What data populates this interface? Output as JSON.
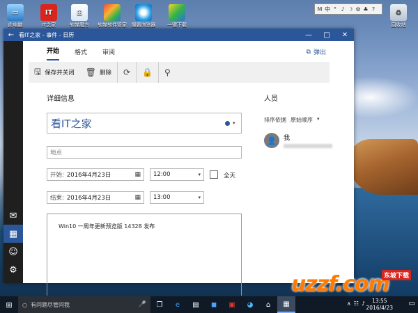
{
  "desktop": {
    "icons": [
      {
        "label": "此电脑",
        "icon": "computer-icon"
      },
      {
        "label": "IT之家",
        "icon": "it-home-icon",
        "glyph": "IT"
      },
      {
        "label": "软媒魔方",
        "icon": "cube-icon"
      },
      {
        "label": "软媒软件管家",
        "icon": "software-manager-icon"
      },
      {
        "label": "搜霸浏览器",
        "icon": "browser-icon"
      },
      {
        "label": "一键下载",
        "icon": "download-icon"
      },
      {
        "label": "回收站",
        "icon": "recycle-bin-icon"
      }
    ],
    "tray_widget": [
      "M",
      "中",
      "°",
      "♪",
      "☽",
      "⚙",
      "♣",
      "?"
    ]
  },
  "window": {
    "title": "看IT之家 - 事件 - 日历",
    "buttons": {
      "minimize": "—",
      "maximize": "□",
      "close": "✕"
    },
    "tabs": [
      {
        "label": "开始",
        "active": true
      },
      {
        "label": "格式",
        "active": false
      },
      {
        "label": "审阅",
        "active": false
      }
    ],
    "popout_label": "弹出",
    "toolbar": {
      "save_close": "保存并关闭",
      "delete": "删除"
    },
    "details": {
      "section_title": "详细信息",
      "subject": "看IT之家",
      "location_placeholder": "地点",
      "start_label": "开始:",
      "start_date": "2016年4月23日",
      "start_time": "12:00",
      "all_day_label": "全天",
      "end_label": "结束:",
      "end_date": "2016年4月23日",
      "end_time": "13:00",
      "notes": "Win10 一周年更新预览版 14328 发布"
    },
    "people": {
      "section_title": "人员",
      "sort_label": "排序依据",
      "sort_value": "原始顺序",
      "person_name": "我"
    }
  },
  "taskbar": {
    "search_placeholder": "有问题尽管问我",
    "clock_time": "13:55",
    "clock_date": "2016/4/23"
  },
  "watermark": {
    "logo": "uzzf.com",
    "cn": "东坡下载"
  },
  "colors": {
    "accent": "#2b579a",
    "taskbar": "#101a26"
  }
}
